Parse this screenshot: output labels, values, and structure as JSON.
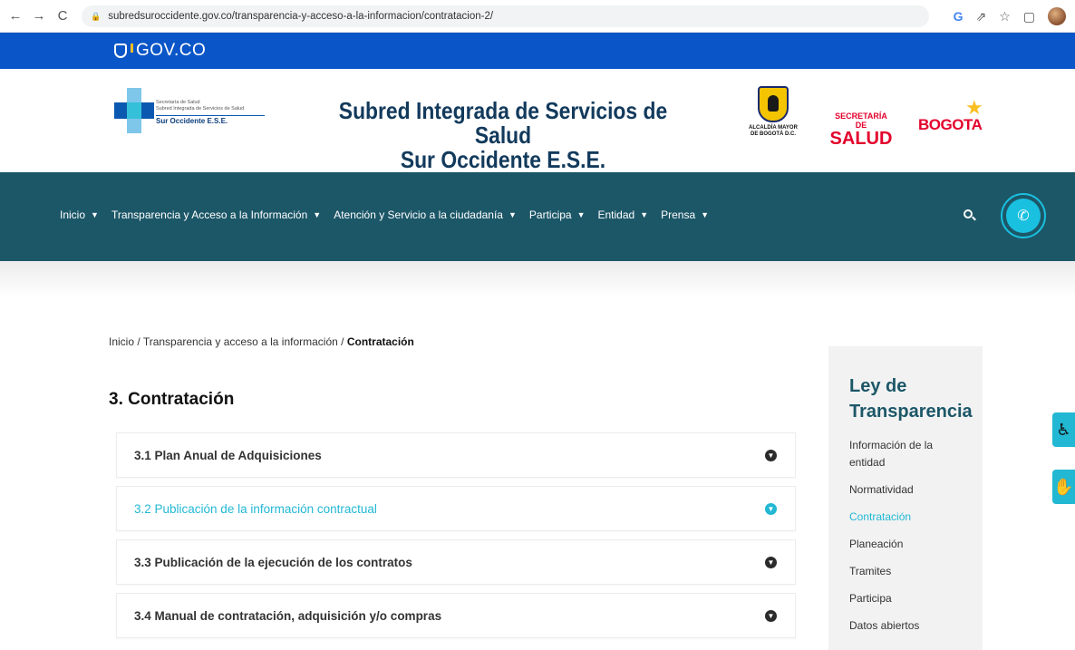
{
  "browser": {
    "url": "subredsuroccidente.gov.co/transparencia-y-acceso-a-la-informacion/contratacion-2/",
    "back": "←",
    "forward": "→",
    "reload": "C",
    "lock": "🔒",
    "g": "G",
    "share": "⇗",
    "star": "☆",
    "window": "▢"
  },
  "gov": {
    "logo_text": "GOV.CO"
  },
  "header": {
    "logo_line1": "Secretaría de Salud",
    "logo_line2": "Subred Integrada de Servicios de Salud",
    "logo_line3": "Sur Occidente E.S.E.",
    "title_line1": "Subred Integrada de Servicios de Salud",
    "title_line2": "Sur Occidente E.S.E.",
    "alcaldia_line1": "ALCALDÍA MAYOR",
    "alcaldia_line2": "DE BOGOTÁ D.C.",
    "secretaria_top": "SECRETARÍA DE",
    "secretaria_bottom": "SALUD",
    "bogota": "BOGOTA"
  },
  "nav": {
    "items": [
      {
        "label": "Inicio"
      },
      {
        "label": "Transparencia y Acceso a la Información"
      },
      {
        "label": "Atención y Servicio a la ciudadanía"
      },
      {
        "label": "Participa"
      },
      {
        "label": "Entidad"
      },
      {
        "label": "Prensa"
      }
    ],
    "chevron": "⌄",
    "phone_glyph": "✆"
  },
  "breadcrumb": {
    "home": "Inicio",
    "sep": " / ",
    "parent": "Transparencia y acceso a la información",
    "current": "Contratación"
  },
  "content": {
    "title": "3. Contratación",
    "items": [
      {
        "label": "3.1 Plan Anual de Adquisiciones"
      },
      {
        "label": "3.2 Publicación de la información contractual"
      },
      {
        "label": "3.3 Publicación de la ejecución de los contratos"
      },
      {
        "label": "3.4 Manual de contratación, adquisición y/o compras"
      }
    ],
    "toggle_glyph": "⌄"
  },
  "sidebar": {
    "title_line1": "Ley de",
    "title_line2": "Transparencia",
    "links": [
      {
        "label": "Información de la entidad"
      },
      {
        "label": "Normatividad"
      },
      {
        "label": "Contratación"
      },
      {
        "label": "Planeación"
      },
      {
        "label": "Tramites"
      },
      {
        "label": "Participa"
      },
      {
        "label": "Datos abiertos"
      }
    ]
  },
  "floating": {
    "accessibility_glyph": "♿",
    "sign_language_glyph": "✋"
  },
  "colors": {
    "gov_blue": "#0a56c8",
    "nav_teal": "#1c5768",
    "accent_cyan": "#22b8d4",
    "brand_red": "#e3002b"
  }
}
